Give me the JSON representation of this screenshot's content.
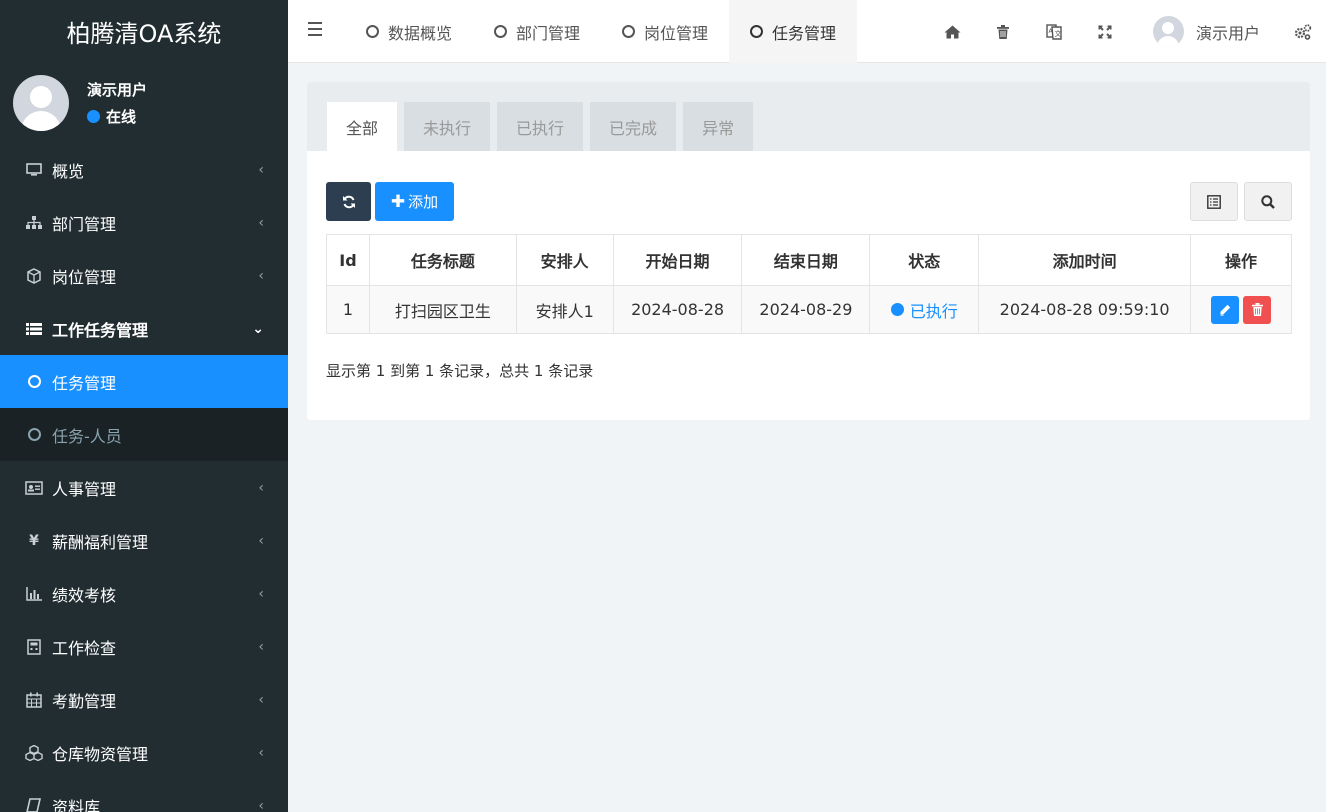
{
  "app": {
    "title": "柏腾清OA系统"
  },
  "user": {
    "name": "演示用户",
    "status": "在线"
  },
  "sidebar": {
    "items": [
      {
        "label": "概览",
        "icon": "monitor-icon"
      },
      {
        "label": "部门管理",
        "icon": "sitemap-icon"
      },
      {
        "label": "岗位管理",
        "icon": "cube-icon"
      },
      {
        "label": "工作任务管理",
        "icon": "list-icon"
      },
      {
        "label": "任务管理",
        "icon": "circle-icon"
      },
      {
        "label": "任务-人员",
        "icon": "circle-icon"
      },
      {
        "label": "人事管理",
        "icon": "id-card-icon"
      },
      {
        "label": "薪酬福利管理",
        "icon": "yen-icon"
      },
      {
        "label": "绩效考核",
        "icon": "bar-chart-icon"
      },
      {
        "label": "工作检查",
        "icon": "calculator-icon"
      },
      {
        "label": "考勤管理",
        "icon": "calendar-icon"
      },
      {
        "label": "仓库物资管理",
        "icon": "cubes-icon"
      },
      {
        "label": "资料库",
        "icon": "book-icon"
      }
    ]
  },
  "topbar": {
    "tabs": [
      {
        "label": "数据概览"
      },
      {
        "label": "部门管理"
      },
      {
        "label": "岗位管理"
      },
      {
        "label": "任务管理"
      }
    ],
    "user_name": "演示用户"
  },
  "panel": {
    "tabs": [
      "全部",
      "未执行",
      "已执行",
      "已完成",
      "异常"
    ],
    "add_label": "添加",
    "columns": [
      "Id",
      "任务标题",
      "安排人",
      "开始日期",
      "结束日期",
      "状态",
      "添加时间",
      "操作"
    ],
    "rows": [
      {
        "id": "1",
        "title": "打扫园区卫生",
        "assignee": "安排人1",
        "start": "2024-08-28",
        "end": "2024-08-29",
        "status": "已执行",
        "created": "2024-08-28 09:59:10"
      }
    ],
    "summary": "显示第 1 到第 1 条记录，总共 1 条记录"
  },
  "colors": {
    "sidebar_bg": "#222d32",
    "accent": "#1890ff",
    "danger": "#f05050",
    "dark_button": "#2c3e50"
  }
}
